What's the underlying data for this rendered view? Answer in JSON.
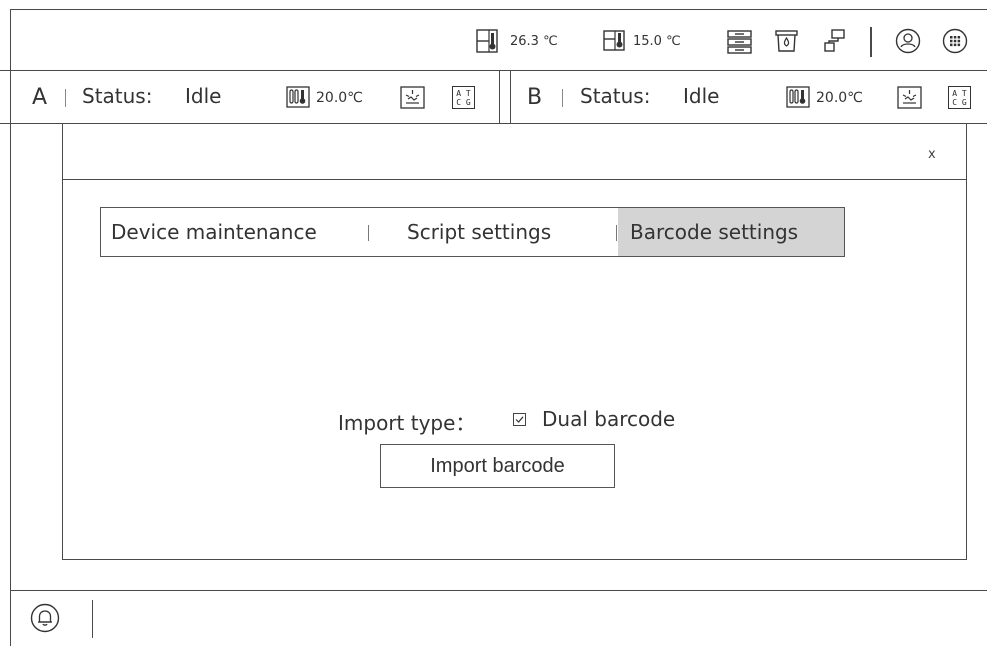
{
  "top_bar": {
    "ambient_temp": "26.3 ℃",
    "fridge_temp": "15.0 ℃",
    "icons": [
      "device-temp-icon",
      "fridge-icon",
      "storage-rack-icon",
      "waste-bin-icon",
      "network-icon",
      "user-icon",
      "apps-grid-icon"
    ]
  },
  "modules": [
    {
      "id": "A",
      "status_label": "Status:",
      "status_value": "Idle",
      "temp": "20.0℃"
    },
    {
      "id": "B",
      "status_label": "Status:",
      "status_value": "Idle",
      "temp": "20.0℃"
    }
  ],
  "module_glyph": {
    "line1": "A T",
    "line2": "C G"
  },
  "dialog": {
    "close": "x",
    "tabs": [
      {
        "label": "Device maintenance",
        "active": false
      },
      {
        "label": "Script settings",
        "active": false
      },
      {
        "label": "Barcode settings",
        "active": true
      }
    ],
    "import_type_label": "Import type：",
    "dual_barcode_label": "Dual barcode",
    "dual_barcode_checked": true,
    "import_button": "Import barcode"
  },
  "bottom_bar": {
    "icons": [
      "bell-icon"
    ]
  },
  "colors": {
    "line": "#4a4a4a",
    "active_tab": "#d4d4d4",
    "text": "#333333"
  }
}
